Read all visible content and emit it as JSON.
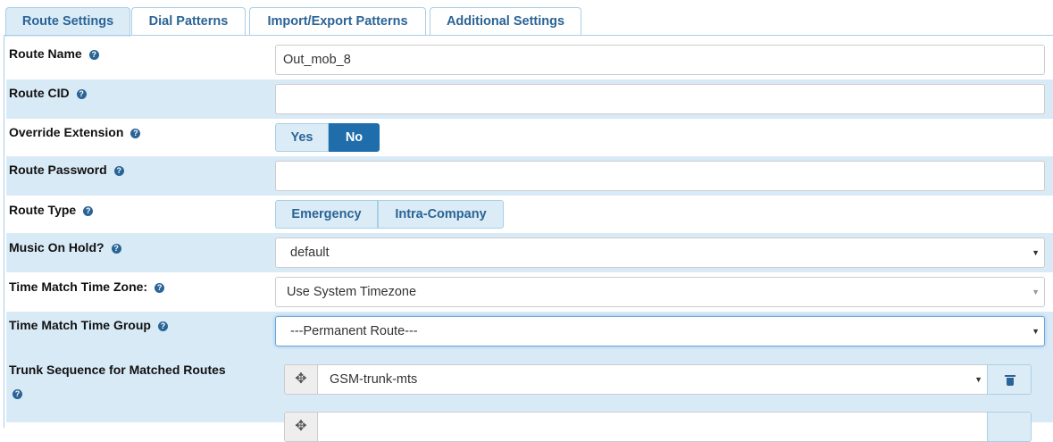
{
  "tabs": [
    {
      "label": "Route Settings",
      "active": true
    },
    {
      "label": "Dial Patterns",
      "active": false
    },
    {
      "label": "Import/Export Patterns",
      "active": false
    },
    {
      "label": "Additional Settings",
      "active": false
    }
  ],
  "help_glyph": "?",
  "fields": {
    "route_name": {
      "label": "Route Name",
      "value": "Out_mob_8"
    },
    "route_cid": {
      "label": "Route CID",
      "value": ""
    },
    "override_extension": {
      "label": "Override Extension",
      "options": [
        "Yes",
        "No"
      ],
      "selected": "No"
    },
    "route_password": {
      "label": "Route Password",
      "value": ""
    },
    "route_type": {
      "label": "Route Type",
      "options": [
        "Emergency",
        "Intra-Company"
      ]
    },
    "music_on_hold": {
      "label": "Music On Hold?",
      "value": "default"
    },
    "time_zone": {
      "label": "Time Match Time Zone:",
      "value": "Use System Timezone"
    },
    "time_group": {
      "label": "Time Match Time Group",
      "value": "---Permanent Route---"
    },
    "trunk_sequence": {
      "label": "Trunk Sequence for Matched Routes",
      "trunks": [
        "GSM-trunk-mts",
        ""
      ]
    }
  },
  "glyphs": {
    "caret": "▼",
    "move": "✥"
  },
  "colors": {
    "accent": "#1f6eab",
    "tab_text": "#2a6496",
    "row_shade": "#d9eaf7"
  }
}
